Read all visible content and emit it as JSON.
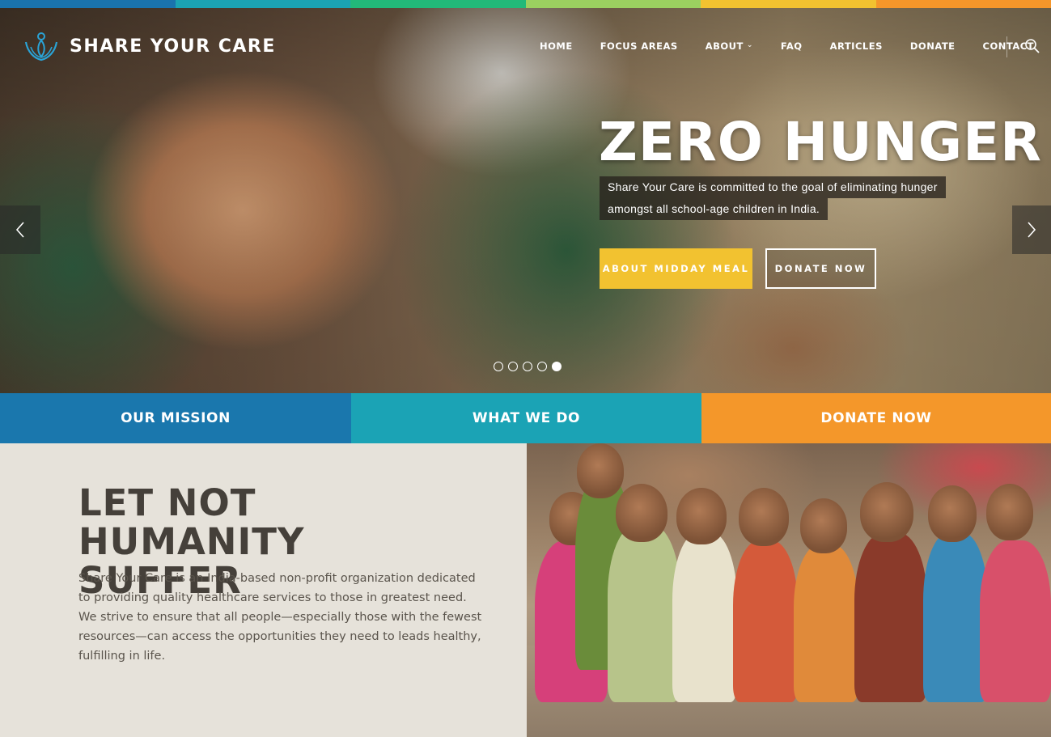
{
  "colors": {
    "strip": [
      "#1a73ad",
      "#1ba3b3",
      "#22b979",
      "#9bd060",
      "#f2c230",
      "#f5962a"
    ],
    "yellow": "#f2c230",
    "tab_mission": "#1a77ad",
    "tab_what": "#1ba3b5",
    "tab_donate": "#f4972a"
  },
  "brand": {
    "name": "SHARE YOUR CARE"
  },
  "nav": {
    "items": [
      "HOME",
      "FOCUS AREAS",
      "ABOUT",
      "FAQ",
      "ARTICLES",
      "DONATE",
      "CONTACT"
    ],
    "search_icon": "search-icon"
  },
  "hero": {
    "title": "ZERO HUNGER",
    "desc_line1": "Share Your Care is committed to the goal of eliminating hunger",
    "desc_line2": "amongst all school-age children in India.",
    "primary_button": "ABOUT MIDDAY MEAL",
    "secondary_button": "DONATE NOW",
    "slides": 5,
    "active_slide": 5
  },
  "tabs": [
    "OUR MISSION",
    "WHAT WE DO",
    "DONATE NOW"
  ],
  "mission": {
    "title": "LET NOT HUMANITY SUFFER",
    "text": "Share Your Care is an India-based non-profit organization dedicated to providing quality healthcare services to those in greatest need. We strive to ensure that all people—especially those with the fewest resources—can access the opportunities they need to leads healthy, fulfilling in life."
  }
}
